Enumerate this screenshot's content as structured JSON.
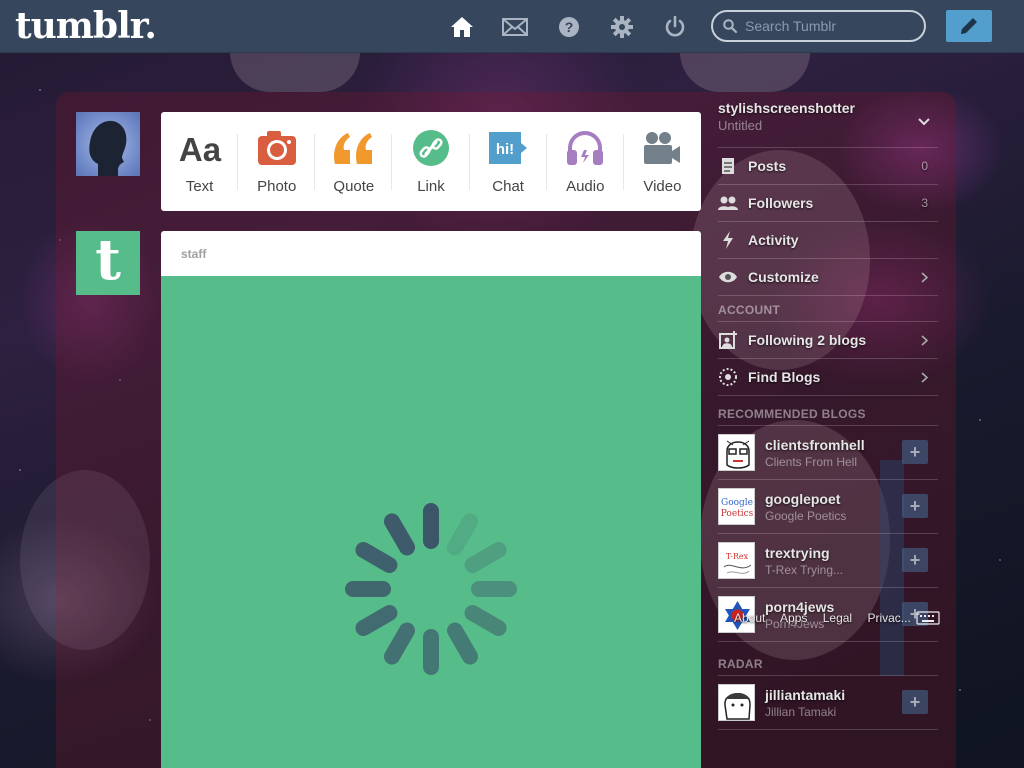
{
  "topbar": {
    "logo": "tumblr.",
    "search_placeholder": "Search Tumblr",
    "icons": [
      "home-icon",
      "mail-icon",
      "help-icon",
      "gear-icon",
      "power-icon",
      "pencil-icon"
    ]
  },
  "post_types": [
    {
      "label": "Text",
      "icon": "text-icon",
      "color": "#444444"
    },
    {
      "label": "Photo",
      "icon": "camera-icon",
      "color": "#d95e40"
    },
    {
      "label": "Quote",
      "icon": "quote-icon",
      "color": "#f2992e"
    },
    {
      "label": "Link",
      "icon": "link-icon",
      "color": "#56bc8a"
    },
    {
      "label": "Chat",
      "icon": "chat-icon",
      "color": "#529ecc"
    },
    {
      "label": "Audio",
      "icon": "headphones-icon",
      "color": "#a77dc2"
    },
    {
      "label": "Video",
      "icon": "video-camera-icon",
      "color": "#748089"
    }
  ],
  "post": {
    "author": "staff",
    "body_color": "#56bc8a",
    "loading": true
  },
  "sidebar": {
    "blog_name": "stylishscreenshotter",
    "blog_title": "Untitled",
    "items": [
      {
        "label": "Posts",
        "count": "0",
        "icon": "document-icon"
      },
      {
        "label": "Followers",
        "count": "3",
        "icon": "people-icon"
      },
      {
        "label": "Activity",
        "count": "",
        "icon": "lightning-icon"
      },
      {
        "label": "Customize",
        "count": "",
        "icon": "eye-icon"
      }
    ],
    "account_heading": "ACCOUNT",
    "account_items": [
      {
        "label": "Following 2 blogs",
        "icon": "following-icon"
      },
      {
        "label": "Find Blogs",
        "icon": "compass-icon"
      }
    ],
    "recommended_heading": "RECOMMENDED BLOGS",
    "recommended": [
      {
        "name": "clientsfromhell",
        "title": "Clients From Hell"
      },
      {
        "name": "googlepoet",
        "title": "Google Poetics"
      },
      {
        "name": "trextrying",
        "title": "T-Rex Trying..."
      },
      {
        "name": "porn4jews",
        "title": "Porn4Jews"
      }
    ],
    "radar_heading": "RADAR",
    "radar": [
      {
        "name": "jilliantamaki",
        "title": "Jillian Tamaki"
      }
    ],
    "thumb_texts": {
      "googlepoet_line1": "Google",
      "googlepoet_line2": "Poetics",
      "trextrying": "T-Rex"
    },
    "footer_links": [
      "About",
      "Apps",
      "Legal",
      "Privac..."
    ]
  },
  "colors": {
    "topbar": "#36465d",
    "accent": "#529ecc",
    "staff_green": "#56bc8a"
  }
}
